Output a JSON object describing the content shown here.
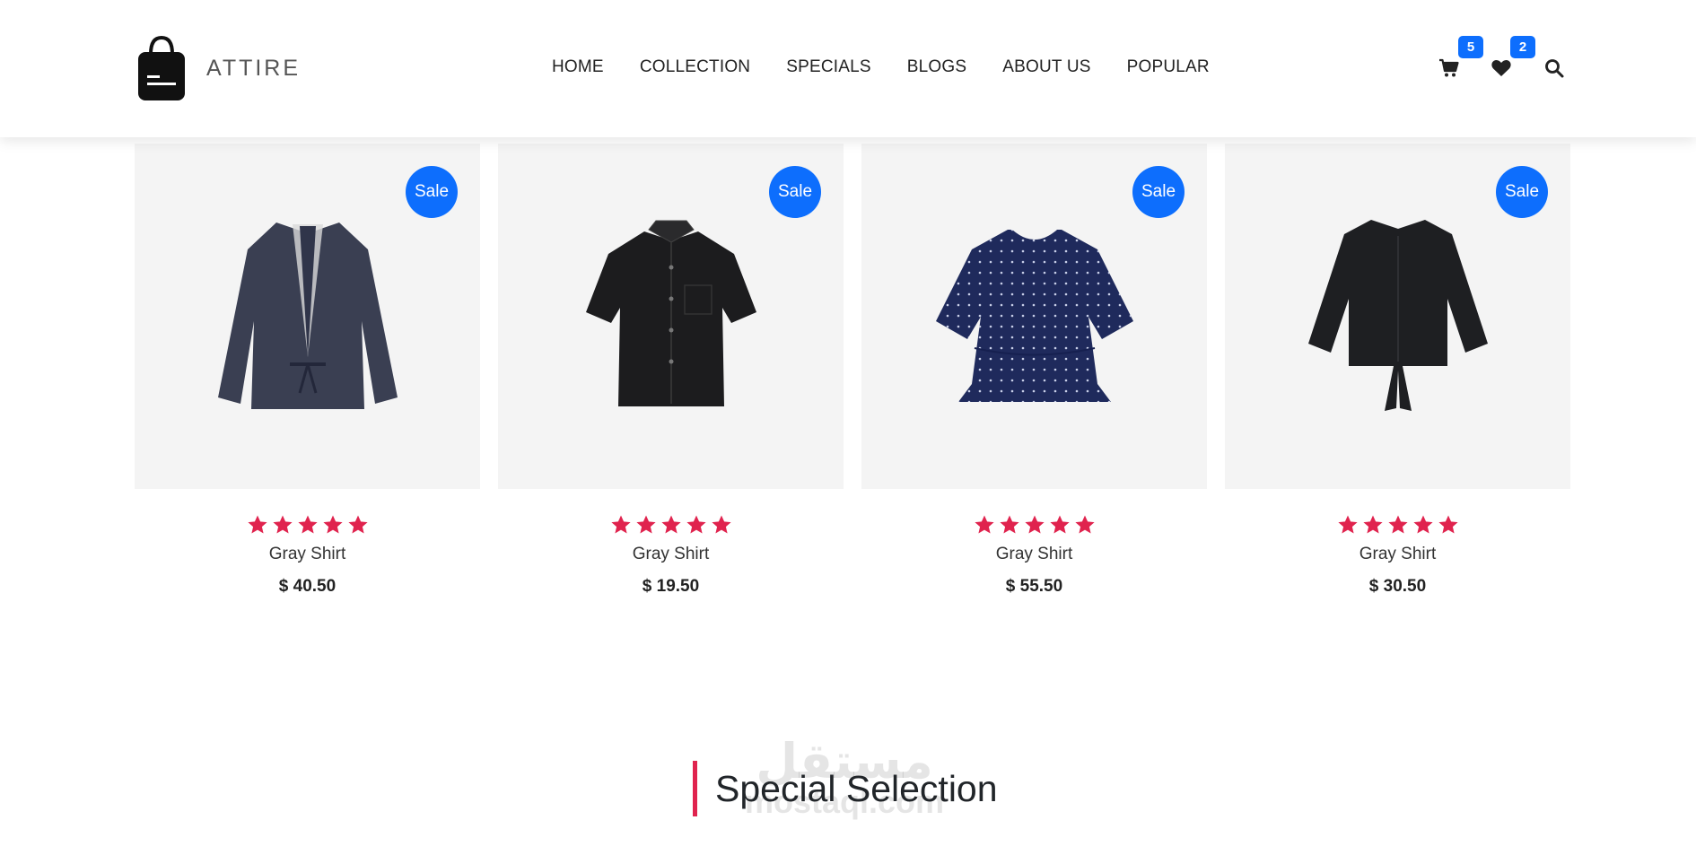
{
  "brand": {
    "name": "ATTIRE"
  },
  "nav": {
    "items": [
      {
        "label": "HOME"
      },
      {
        "label": "COLLECTION"
      },
      {
        "label": "SPECIALS"
      },
      {
        "label": "BLOGS"
      },
      {
        "label": "ABOUT US"
      },
      {
        "label": "POPULAR"
      }
    ]
  },
  "header_actions": {
    "cart": {
      "icon": "cart-icon",
      "count": "5"
    },
    "wishlist": {
      "icon": "heart-icon",
      "count": "2"
    },
    "search": {
      "icon": "search-icon"
    }
  },
  "colors": {
    "accent": "#0d6efd",
    "star": "#e0234e",
    "section_bar": "#e0234e",
    "card_bg": "#f4f4f4"
  },
  "products": [
    {
      "badge": "Sale",
      "name": "Gray Shirt",
      "price": "$ 40.50",
      "rating": 5,
      "image": "jacket-image"
    },
    {
      "badge": "Sale",
      "name": "Gray Shirt",
      "price": "$ 19.50",
      "rating": 5,
      "image": "shirt-image"
    },
    {
      "badge": "Sale",
      "name": "Gray Shirt",
      "price": "$ 55.50",
      "rating": 5,
      "image": "dotted-blouse-image"
    },
    {
      "badge": "Sale",
      "name": "Gray Shirt",
      "price": "$ 30.50",
      "rating": 5,
      "image": "black-top-image"
    }
  ],
  "section": {
    "title": "Special Selection"
  },
  "watermark": {
    "arabic": "مستقل",
    "latin": "mostaql.com"
  }
}
